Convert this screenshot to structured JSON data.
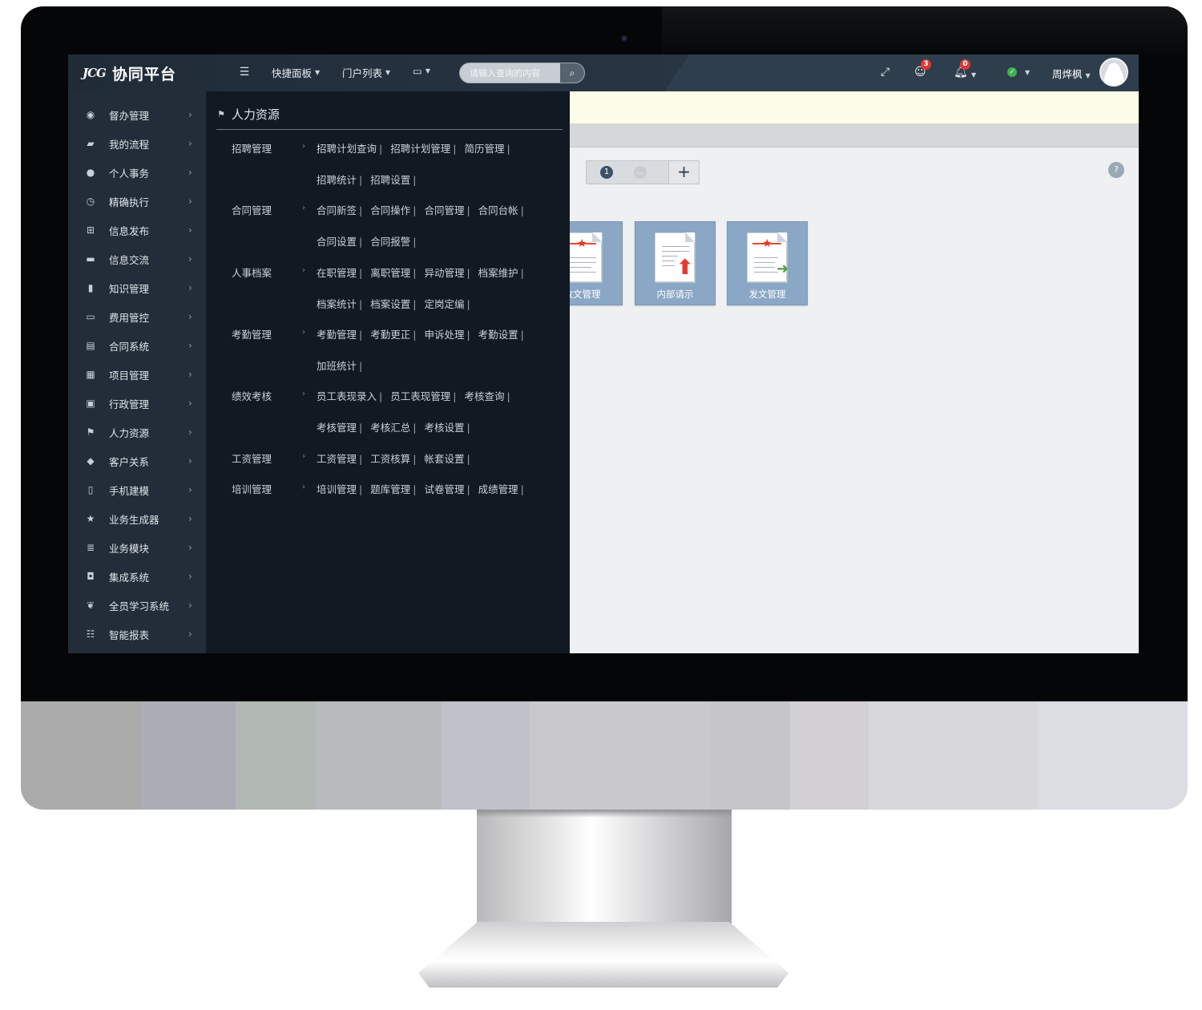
{
  "app": {
    "logo_mark": "JCG",
    "title": "协同平台"
  },
  "topbar": {
    "menu_icon": "list-icon",
    "quick_panel": "快捷面板",
    "portal_list": "门户列表",
    "monitor_icon": "monitor-icon",
    "search_placeholder": "请输入查询的内容",
    "search_icon": "search-icon",
    "expand_icon": "expand-icon",
    "user_alerts_badge": "3",
    "notifications_badge": "0",
    "status_icon": "check-circle-icon",
    "username": "周烨枫"
  },
  "sidebar": {
    "items": [
      {
        "label": "督办管理",
        "icon": "eye-icon"
      },
      {
        "label": "我的流程",
        "icon": "folder-open-icon"
      },
      {
        "label": "个人事务",
        "icon": "user-icon"
      },
      {
        "label": "精确执行",
        "icon": "clock-icon"
      },
      {
        "label": "信息发布",
        "icon": "grid-icon"
      },
      {
        "label": "信息交流",
        "icon": "comment-icon"
      },
      {
        "label": "知识管理",
        "icon": "bookmark-icon"
      },
      {
        "label": "费用管控",
        "icon": "credit-card-icon"
      },
      {
        "label": "合同系统",
        "icon": "document-icon"
      },
      {
        "label": "项目管理",
        "icon": "calendar-icon"
      },
      {
        "label": "行政管理",
        "icon": "briefcase-icon"
      },
      {
        "label": "人力资源",
        "icon": "flag-icon"
      },
      {
        "label": "客户关系",
        "icon": "tags-icon"
      },
      {
        "label": "手机建模",
        "icon": "mobile-icon"
      },
      {
        "label": "业务生成器",
        "icon": "star-icon"
      },
      {
        "label": "业务模块",
        "icon": "server-icon"
      },
      {
        "label": "集成系统",
        "icon": "inbox-icon"
      },
      {
        "label": "全员学习系统",
        "icon": "leaf-icon"
      },
      {
        "label": "智能报表",
        "icon": "list-icon"
      }
    ]
  },
  "flyout": {
    "title": "人力资源",
    "groups": [
      {
        "label": "招聘管理",
        "rows": [
          [
            "招聘计划查询",
            "招聘计划管理",
            "简历管理"
          ],
          [
            "招聘统计",
            "招聘设置"
          ]
        ]
      },
      {
        "label": "合同管理",
        "rows": [
          [
            "合同新签",
            "合同操作",
            "合同管理",
            "合同台帐"
          ],
          [
            "合同设置",
            "合同报警"
          ]
        ]
      },
      {
        "label": "人事档案",
        "rows": [
          [
            "在职管理",
            "离职管理",
            "异动管理",
            "档案维护"
          ],
          [
            "档案统计",
            "档案设置",
            "定岗定编"
          ]
        ]
      },
      {
        "label": "考勤管理",
        "rows": [
          [
            "考勤管理",
            "考勤更正",
            "申诉处理",
            "考勤设置"
          ],
          [
            "加班统计"
          ]
        ]
      },
      {
        "label": "绩效考核",
        "rows": [
          [
            "员工表现录入",
            "员工表现管理",
            "考核查询"
          ],
          [
            "考核管理",
            "考核汇总",
            "考核设置"
          ]
        ]
      },
      {
        "label": "工资管理",
        "rows": [
          [
            "工资管理",
            "工资核算",
            "帐套设置"
          ]
        ]
      },
      {
        "label": "培训管理",
        "rows": [
          [
            "培训管理",
            "题库管理",
            "试卷管理",
            "成绩管理"
          ]
        ]
      }
    ]
  },
  "content": {
    "pager": {
      "current": "1",
      "more": "...",
      "add": "+"
    },
    "help": "?",
    "tiles": [
      {
        "label": "收文管理"
      },
      {
        "label": "内部请示"
      },
      {
        "label": "发文管理"
      }
    ]
  }
}
